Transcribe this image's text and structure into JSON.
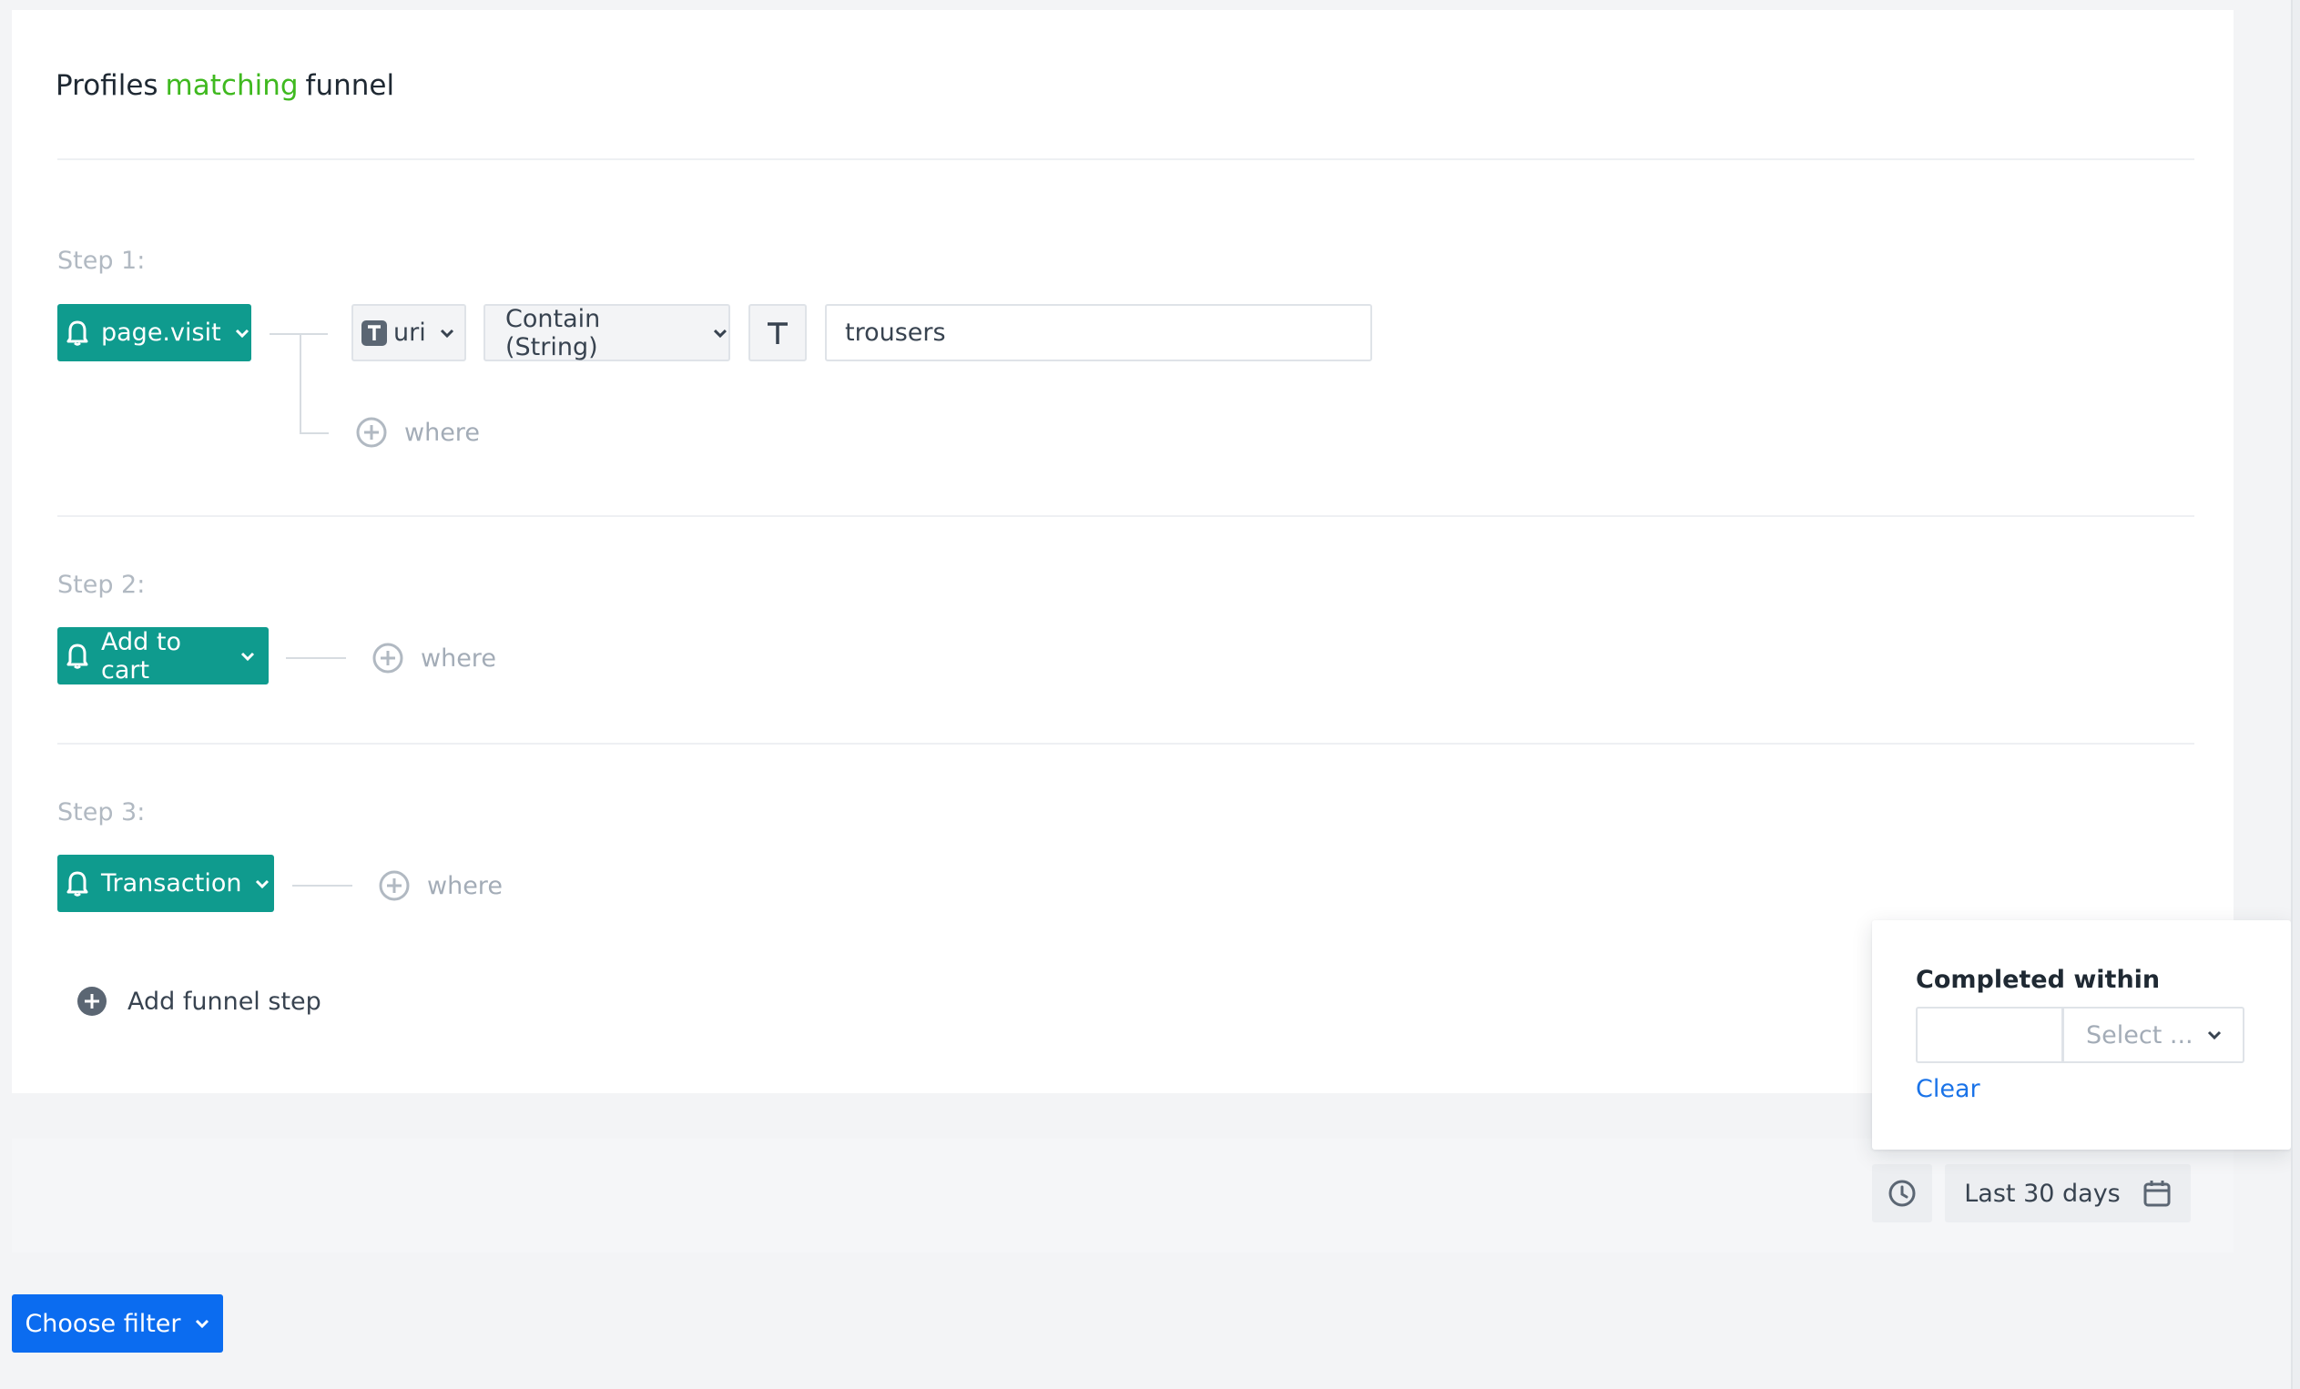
{
  "header": {
    "title_part1": "Profiles",
    "title_accent": "matching",
    "title_part2": "funnel"
  },
  "colors": {
    "accent_green": "#3fb91f",
    "event_teal": "#0f9b8e",
    "primary_blue": "#0b6cf0",
    "link_blue": "#1a73e8"
  },
  "steps": [
    {
      "label": "Step 1:",
      "event": "page.visit",
      "condition": {
        "param_type_icon": "text-type-icon",
        "param": "uri",
        "operator": "Contain (String)",
        "value_type_icon": "text-type-icon",
        "value": "trousers"
      },
      "where_label": "where"
    },
    {
      "label": "Step 2:",
      "event": "Add to cart",
      "where_label": "where"
    },
    {
      "label": "Step 3:",
      "event": "Transaction",
      "where_label": "where"
    }
  ],
  "add_step_label": "Add funnel step",
  "completed_within": {
    "title": "Completed within",
    "amount_value": "",
    "unit_placeholder": "Select ...",
    "clear_label": "Clear"
  },
  "date_range": {
    "label": "Last 30 days"
  },
  "filter_button": {
    "label": "Choose filter"
  }
}
